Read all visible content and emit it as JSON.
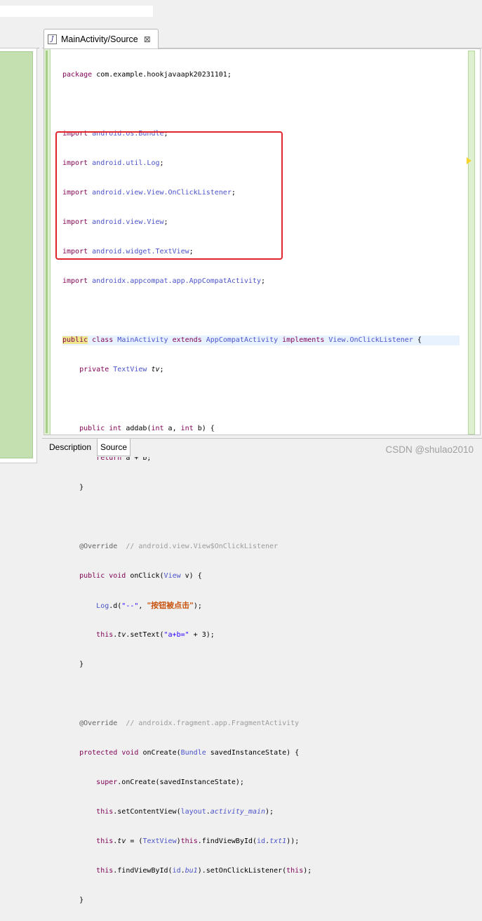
{
  "tab": {
    "title": "MainActivity/Source",
    "icon": "java-file-icon",
    "close": "⊠"
  },
  "bottom_tabs": {
    "description": "Description",
    "source": "Source"
  },
  "watermark": "CSDN @shulao2010",
  "code_lines": [
    "package com.example.hookjavaapk20231101;",
    "",
    "import android.os.Bundle;",
    "import android.util.Log;",
    "import android.view.View.OnClickListener;",
    "import android.view.View;",
    "import android.widget.TextView;",
    "import androidx.appcompat.app.AppCompatActivity;",
    "",
    "public class MainActivity extends AppCompatActivity implements View.OnClickListener {",
    "    private TextView tv;",
    "",
    "    public int addab(int a, int b) {",
    "        return a + b;",
    "    }",
    "",
    "    @Override  // android.view.View$OnClickListener",
    "    public void onClick(View v) {",
    "        Log.d(\"--\", \"按钮被点击\");",
    "        this.tv.setText(\"a+b=\" + 3);",
    "    }",
    "",
    "    @Override  // androidx.fragment.app.FragmentActivity",
    "    protected void onCreate(Bundle savedInstanceState) {",
    "        super.onCreate(savedInstanceState);",
    "        this.setContentView(layout.activity_main);",
    "        this.tv = (TextView)this.findViewById(id.txt1);",
    "        this.findViewById(id.bu1).setOnClickListener(this);",
    "    }",
    "}"
  ],
  "colors": {
    "keyword": "#7f0055",
    "type": "#4a52c9",
    "string": "#2a00ff",
    "annotation_box": "#e0262a"
  }
}
